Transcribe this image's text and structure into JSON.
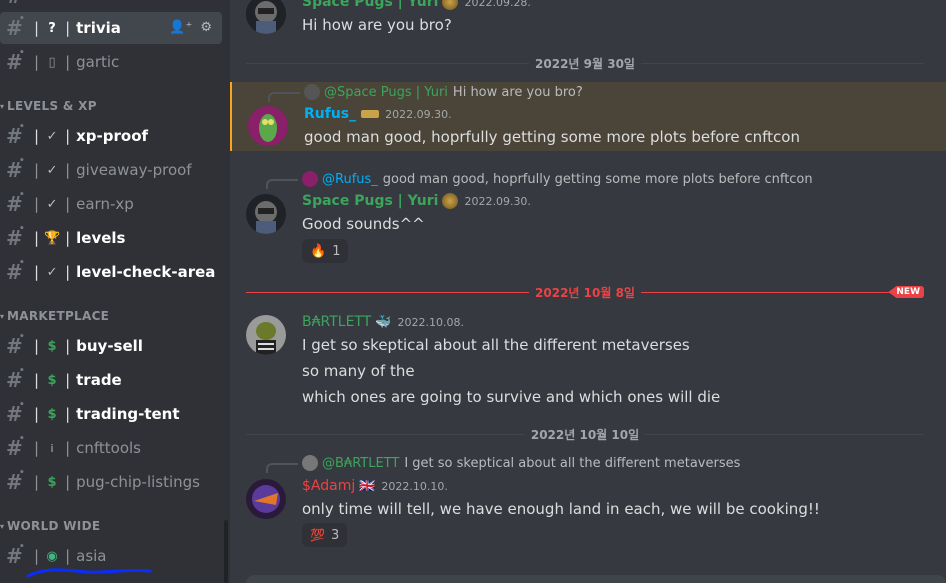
{
  "sidebar": {
    "channels_top": [
      {
        "name": "trivia",
        "prefix_icon": "question-mark-icon",
        "prefix_text": "?",
        "state": "active"
      },
      {
        "name": "gartic",
        "prefix_icon": "missing-glyph-icon",
        "prefix_text": "▯",
        "state": "muted"
      }
    ],
    "categories": [
      {
        "label": "LEVELS & XP"
      },
      {
        "label": "MARKETPLACE"
      },
      {
        "label": "WORLD WIDE"
      }
    ],
    "levels_channels": [
      {
        "name": "xp-proof",
        "prefix_icon": "check-icon",
        "prefix_text": "✓",
        "state": "unread"
      },
      {
        "name": "giveaway-proof",
        "prefix_icon": "check-icon",
        "prefix_text": "✓",
        "state": "muted"
      },
      {
        "name": "earn-xp",
        "prefix_icon": "check-icon",
        "prefix_text": "✓",
        "state": "muted"
      },
      {
        "name": "levels",
        "prefix_icon": "trophy-icon",
        "prefix_text": "🏆",
        "state": "unread"
      },
      {
        "name": "level-check-area",
        "prefix_icon": "check-icon",
        "prefix_text": "✓",
        "state": "unread"
      }
    ],
    "market_channels": [
      {
        "name": "buy-sell",
        "prefix_icon": "money-bag-icon",
        "prefix_text": "$",
        "state": "unread"
      },
      {
        "name": "trade",
        "prefix_icon": "money-bag-icon",
        "prefix_text": "$",
        "state": "unread"
      },
      {
        "name": "trading-tent",
        "prefix_icon": "money-bag-icon",
        "prefix_text": "$",
        "state": "unread"
      },
      {
        "name": "cnfttools",
        "prefix_icon": "info-icon",
        "prefix_text": "i",
        "state": "muted"
      },
      {
        "name": "pug-chip-listings",
        "prefix_icon": "money-bag-icon",
        "prefix_text": "$",
        "state": "muted"
      }
    ],
    "world_channels": [
      {
        "name": "asia",
        "prefix_icon": "globe-icon",
        "prefix_text": "◉",
        "state": "muted"
      }
    ]
  },
  "chat": {
    "msg1": {
      "username": "Space Pugs | Yuri",
      "timestamp": "2022.09.28.",
      "text": "Hi how are you bro?",
      "username_color": "#3ba55c"
    },
    "divider1": "2022년 9월 30일",
    "msg2": {
      "reply_to": "@Space Pugs | Yuri",
      "reply_text": "Hi how are you bro?",
      "username": "Rufus_",
      "timestamp": "2022.09.30.",
      "text": "good man good, hoprfully getting some more plots before cnftcon",
      "username_color": "#00b0f4",
      "reply_color": "#3ba55c"
    },
    "msg3": {
      "reply_to": "@Rufus_",
      "reply_text": "good man good, hoprfully getting some more plots before cnftcon",
      "username": "Space Pugs | Yuri",
      "timestamp": "2022.09.30.",
      "text": "Good sounds^^",
      "reaction_emoji": "🔥",
      "reaction_count": "1",
      "username_color": "#3ba55c",
      "reply_color": "#00b0f4"
    },
    "divider2": "2022년 10월 8일",
    "new_badge": "NEW",
    "msg4": {
      "username": "B₳RTLETT",
      "timestamp": "2022.10.08.",
      "lines": [
        "I get so skeptical about all the different metaverses",
        "so many of the",
        "which ones are going to survive and which ones will die"
      ],
      "username_color": "#3ba55c"
    },
    "divider3": "2022년 10월 10일",
    "msg5": {
      "reply_to": "@B₳RTLETT",
      "reply_text": "I get so skeptical about all the different metaverses",
      "username": "$Adamj",
      "timestamp": "2022.10.10.",
      "text": "only time will tell, we have enough land in each, we will be cooking!!",
      "reaction_emoji": "💯",
      "reaction_count": "3",
      "username_color": "#ed4245",
      "reply_color": "#3ba55c"
    }
  },
  "colors": {
    "sidebar_bg": "#2f3136",
    "chat_bg": "#36393f",
    "highlight_bg": "#4a4538",
    "highlight_bar": "#faa61a",
    "new_red": "#ed4245",
    "annotation_blue": "#0a2cff"
  }
}
